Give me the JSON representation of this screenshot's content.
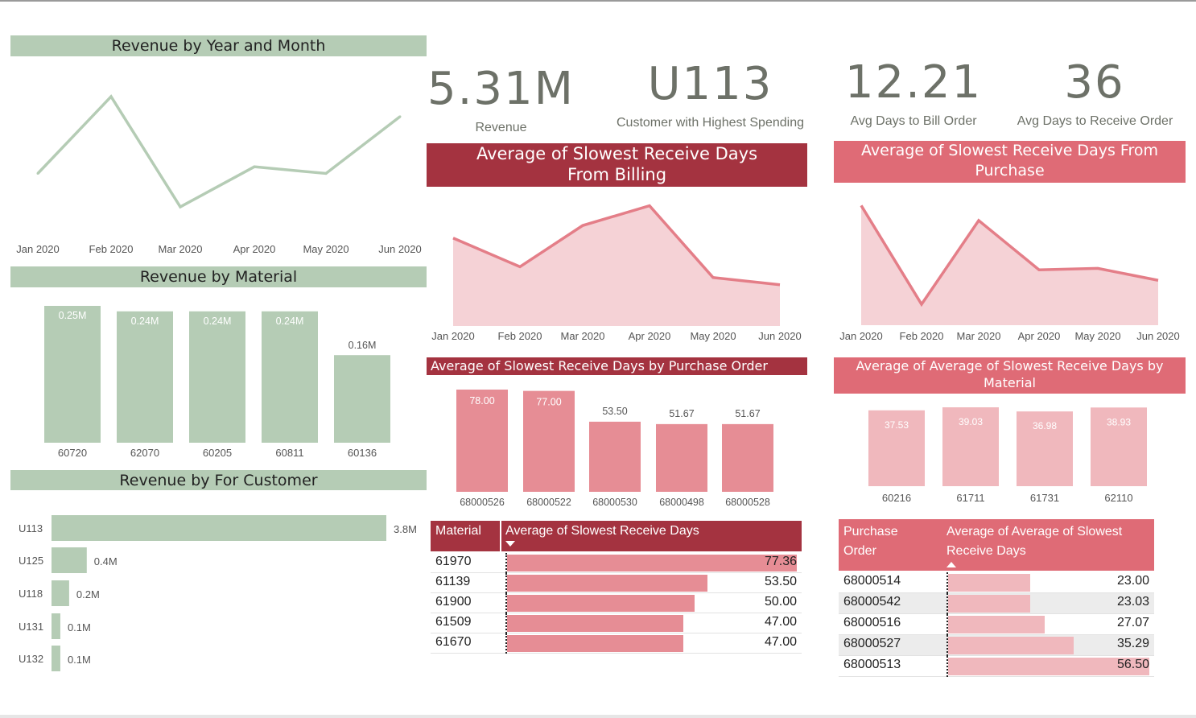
{
  "kpis": [
    {
      "value": "5.31M",
      "label": "Revenue"
    },
    {
      "value": "U113",
      "label": "Customer with Highest Spending"
    },
    {
      "value": "12.21",
      "label": "Avg  Days to Bill Order"
    },
    {
      "value": "36",
      "label": "Avg Days to Receive Order"
    }
  ],
  "colors": {
    "green": "#b5ccb5",
    "green_line": "#b5ccb5",
    "dark_red": "#a43340",
    "pink": "#df6b76",
    "pink_line": "#e47e88",
    "pink_fill": "#f5d2d6",
    "bar_pink": "#e68d95",
    "bar_light": "#f0b8bd"
  },
  "chart_data": [
    {
      "id": "revenue-by-month",
      "type": "line",
      "title": "Revenue by Year and Month",
      "categories": [
        "Jan 2020",
        "Feb 2020",
        "Mar 2020",
        "Apr 2020",
        "May 2020",
        "Jun 2020"
      ],
      "values": [
        0.84,
        1.07,
        0.74,
        0.86,
        0.84,
        1.01
      ]
    },
    {
      "id": "revenue-by-material",
      "type": "bar",
      "title": "Revenue by Material",
      "categories": [
        "60720",
        "62070",
        "60205",
        "60811",
        "60136"
      ],
      "values": [
        0.25,
        0.24,
        0.24,
        0.24,
        0.16
      ],
      "labels": [
        "0.25M",
        "0.24M",
        "0.24M",
        "0.24M",
        "0.16M"
      ]
    },
    {
      "id": "revenue-by-customer",
      "type": "bar",
      "title": "Revenue by For Customer",
      "categories": [
        "U113",
        "U125",
        "U118",
        "U131",
        "U132"
      ],
      "values": [
        3.8,
        0.4,
        0.2,
        0.1,
        0.1
      ],
      "labels": [
        "3.8M",
        "0.4M",
        "0.2M",
        "0.1M",
        "0.1M"
      ]
    },
    {
      "id": "slowest-from-billing",
      "type": "area",
      "title": "Average of Slowest Receive Days From Billing",
      "categories": [
        "Jan 2020",
        "Feb 2020",
        "Mar 2020",
        "Apr 2020",
        "May 2020",
        "Jun 2020"
      ],
      "values": [
        37,
        21,
        44,
        55,
        15,
        11
      ],
      "ylim": [
        -12,
        62
      ]
    },
    {
      "id": "slowest-from-purchase",
      "type": "area",
      "title": "Average of Slowest Receive Days From Purchase",
      "categories": [
        "Jan 2020",
        "Feb 2020",
        "Mar 2020",
        "Apr 2020",
        "May 2020",
        "Jun 2020"
      ],
      "values": [
        80,
        14,
        70,
        37,
        38,
        30
      ],
      "ylim": [
        0,
        85
      ]
    },
    {
      "id": "slowest-by-po",
      "type": "bar",
      "title": "Average of Slowest Receive Days by Purchase Order",
      "categories": [
        "68000526",
        "68000522",
        "68000530",
        "68000498",
        "68000528"
      ],
      "values": [
        78.0,
        77.0,
        53.5,
        51.67,
        51.67
      ],
      "labels": [
        "78.00",
        "77.00",
        "53.50",
        "51.67",
        "51.67"
      ]
    },
    {
      "id": "avg-slowest-by-material",
      "type": "bar",
      "title": "Average of Average of Slowest Receive Days by Material",
      "categories": [
        "60216",
        "61711",
        "61731",
        "62110"
      ],
      "values": [
        37.53,
        39.03,
        36.98,
        38.93
      ],
      "labels": [
        "37.53",
        "39.03",
        "36.98",
        "38.93"
      ]
    },
    {
      "id": "table-material",
      "type": "table",
      "columns": [
        "Material",
        "Average of Slowest Receive Days"
      ],
      "rows": [
        [
          "61970",
          "77.36"
        ],
        [
          "61139",
          "53.50"
        ],
        [
          "61900",
          "50.00"
        ],
        [
          "61509",
          "47.00"
        ],
        [
          "61670",
          "47.00"
        ]
      ],
      "values": [
        77.36,
        53.5,
        50.0,
        47.0,
        47.0
      ]
    },
    {
      "id": "table-po",
      "type": "table",
      "columns": [
        "Purchase Order",
        "Average of Average of Slowest Receive Days"
      ],
      "rows": [
        [
          "68000514",
          "23.00"
        ],
        [
          "68000542",
          "23.03"
        ],
        [
          "68000516",
          "27.07"
        ],
        [
          "68000527",
          "35.29"
        ],
        [
          "68000513",
          "56.50"
        ]
      ],
      "values": [
        23.0,
        23.03,
        27.07,
        35.29,
        56.5
      ]
    }
  ]
}
